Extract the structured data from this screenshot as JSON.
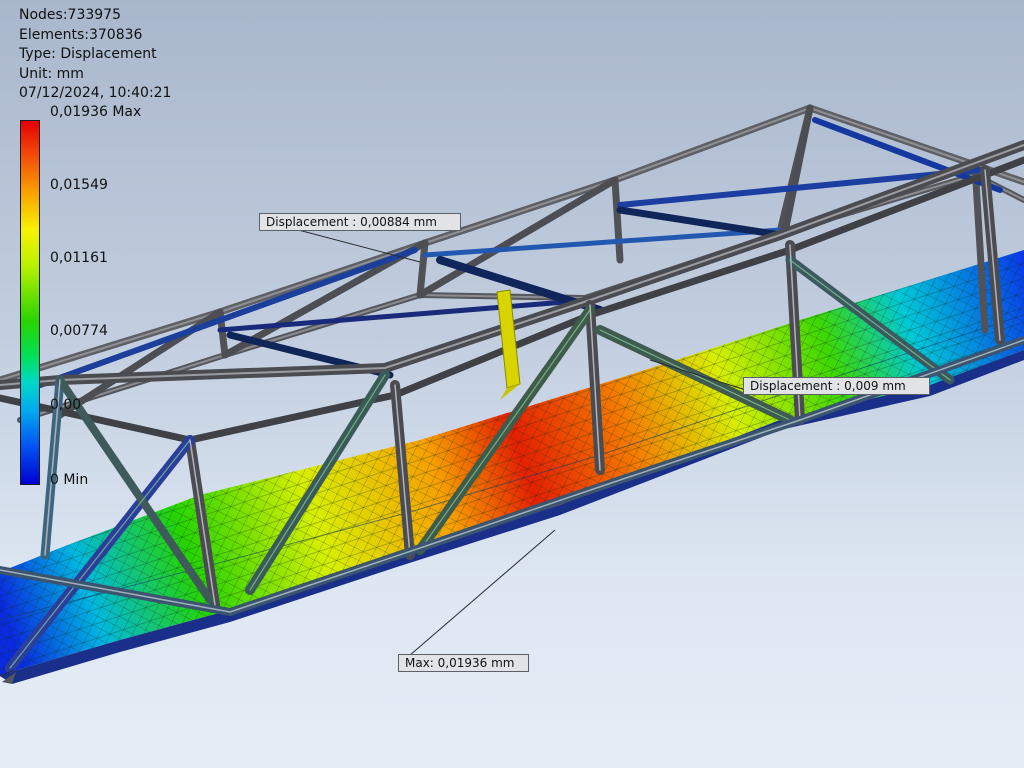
{
  "info": {
    "nodes": "Nodes:733975",
    "elements": "Elements:370836",
    "type": "Type: Displacement",
    "unit": "Unit: mm",
    "datetime": "07/12/2024, 10:40:21"
  },
  "legend": {
    "max_label": "0,01936 Max",
    "ticks": [
      "0,01549",
      "0,01161",
      "0,00774",
      "0,00"
    ],
    "min_label": "0 Min",
    "colors": [
      "#e40000",
      "#f8a400",
      "#f7f200",
      "#2ad400",
      "#00d8c8",
      "#0050f0",
      "#0000d2"
    ]
  },
  "callouts": {
    "displacement_1": "Displacement : 0,00884 mm",
    "displacement_2": "Displacement : 0,009 mm",
    "max": "Max: 0,01936 mm"
  }
}
